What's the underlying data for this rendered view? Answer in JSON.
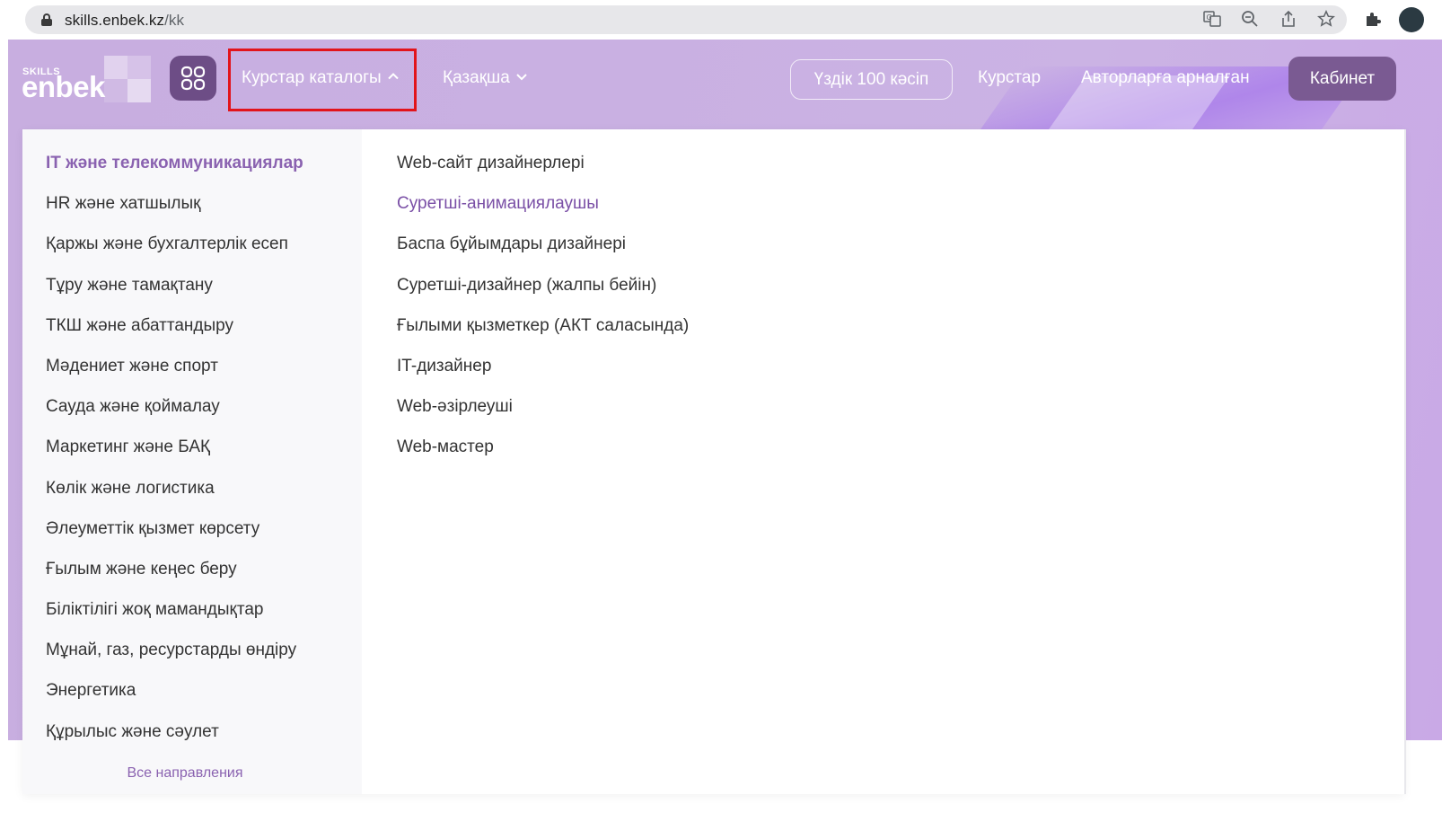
{
  "browser": {
    "url_host": "skills.enbek.kz",
    "url_path": "/kk",
    "icons": [
      "translate-icon",
      "zoom-icon",
      "share-icon",
      "bookmark-star-icon",
      "extensions-icon",
      "profile-avatar"
    ]
  },
  "header": {
    "logo_small": "SKILLS",
    "logo_big": "enbek",
    "nav": {
      "catalog": "Курстар каталогы",
      "language": "Қазақша",
      "top100": "Үздік 100 кәсіп",
      "courses": "Курстар",
      "authors": "Авторларға арналған",
      "cabinet": "Кабинет"
    }
  },
  "dropdown": {
    "categories": [
      "IT және телекоммуникациялар",
      "HR және хатшылық",
      "Қаржы және бухгалтерлік есеп",
      "Тұру және тамақтану",
      "ТКШ және абаттандыру",
      "Мәдениет және спорт",
      "Сауда және қоймалау",
      "Маркетинг және БАҚ",
      "Көлік және логистика",
      "Әлеуметтік қызмет көрсету",
      "Ғылым және кеңес беру",
      "Біліктілігі жоқ мамандықтар",
      "Мұнай, газ, ресурстарды өндіру",
      "Энергетика",
      "Құрылыс және сәулет"
    ],
    "active_category": 0,
    "all_directions": "Все направления",
    "subcategories": [
      "Web-сайт дизайнерлері",
      "Суретші-анимациялаушы",
      "Баспа бұйымдары дизайнері",
      "Суретші-дизайнер (жалпы бейін)",
      "Ғылыми қызметкер (АКТ саласында)",
      "IT-дизайнер",
      "Web-әзірлеуші",
      "Web-мастер"
    ],
    "hovered_subcategory": 1
  },
  "colors": {
    "header_bg": "#c9b0e2",
    "accent": "#8a62b0",
    "button_dark": "#6d4d86",
    "highlight_box": "#e2141b"
  }
}
